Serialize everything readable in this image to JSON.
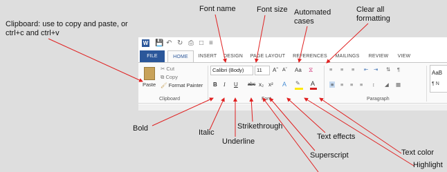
{
  "annotations": {
    "clipboard": "Clipboard: use to copy and paste, or",
    "clipboard_line2": "ctrl+c and ctrl+v",
    "font_name": "Font name",
    "font_size": "Font size",
    "automated_line1": "Automated",
    "automated_line2": "cases",
    "clear_line1": "Clear all",
    "clear_line2": "formatting",
    "bold": "Bold",
    "italic": "Italic",
    "underline": "Underline",
    "strikethrough": "Strikethrough",
    "text_effects": "Text effects",
    "superscript": "Superscript",
    "text_color": "Text color",
    "highlight": "Highlight"
  },
  "tabs": [
    "FILE",
    "HOME",
    "INSERT",
    "DESIGN",
    "PAGE LAYOUT",
    "REFERENCES",
    "MAILINGS",
    "REVIEW",
    "VIEW"
  ],
  "ribbon": {
    "paste": "Paste",
    "cut": "Cut",
    "copy": "Copy",
    "format_painter": "Format Painter",
    "font_name_value": "Calibri (Body)",
    "font_size_value": "11",
    "grow_font": "Aˆ",
    "shrink_font": "Aˇ",
    "change_case": "Aa",
    "bold": "B",
    "italic": "I",
    "underline": "U",
    "strike": "abc",
    "subscript": "x₂",
    "superscript": "x²",
    "clipboard_group": "Clipboard",
    "font_group": "Font",
    "paragraph_group": "Paragraph",
    "style_preview": "AaB",
    "style_name": "¶ N"
  },
  "colors": {
    "word_blue": "#2b579a",
    "arrow_red": "#e02020",
    "font_color": "#d62020",
    "highlight": "#ffe800"
  }
}
